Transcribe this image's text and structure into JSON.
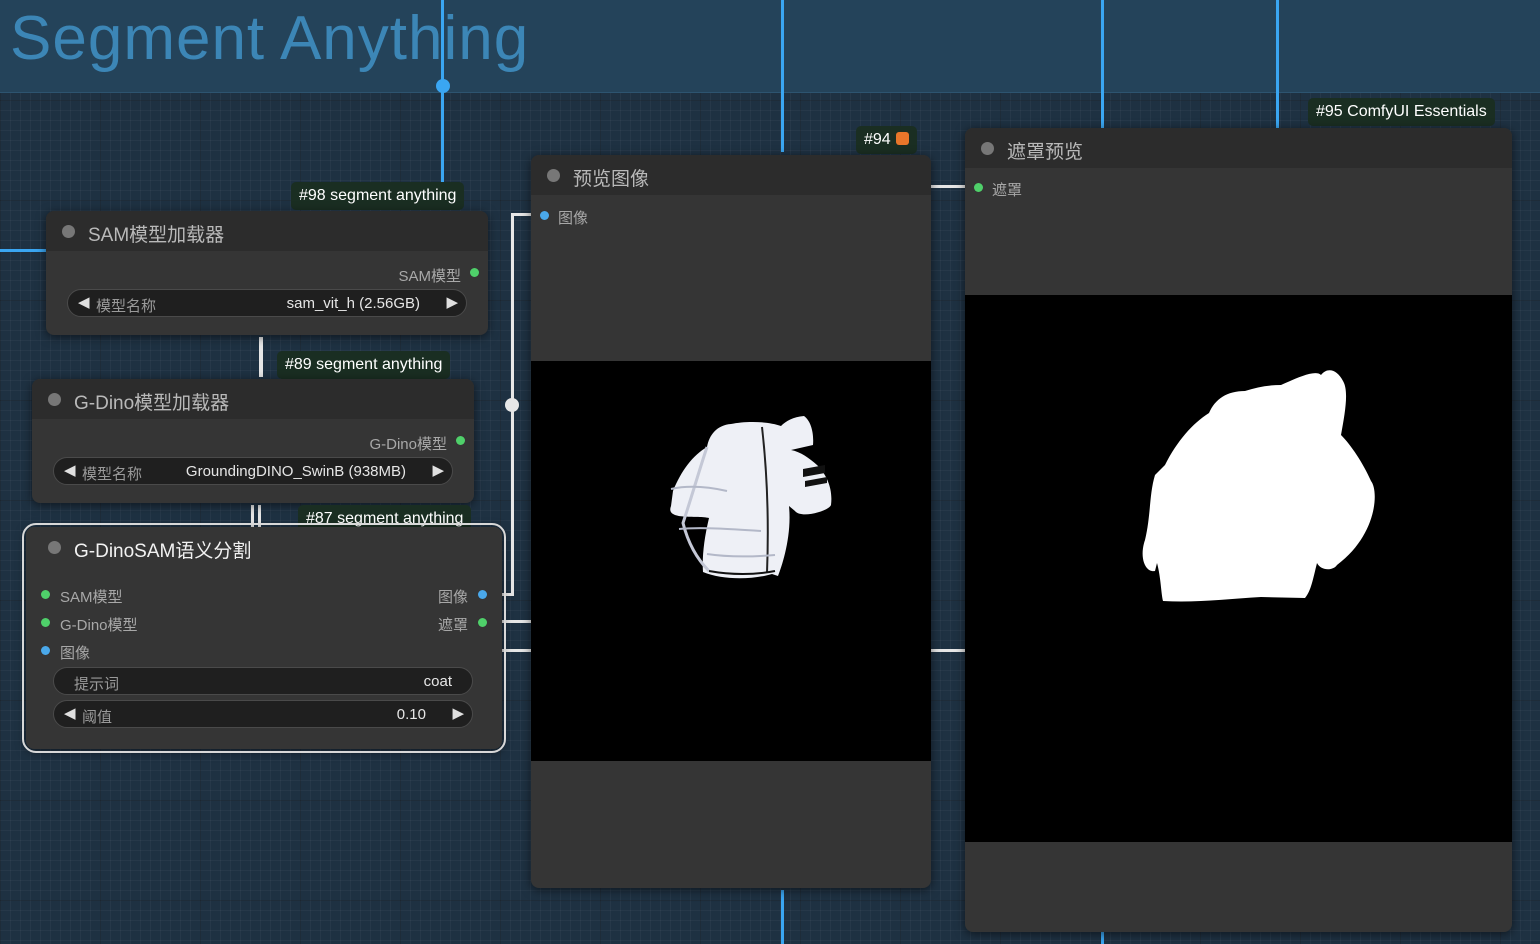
{
  "group": {
    "title": "Segment Anything"
  },
  "nodes": {
    "sam_loader": {
      "badge": "#98 segment anything",
      "title": "SAM模型加载器",
      "output_label": "SAM模型",
      "widget": {
        "label": "模型名称",
        "value": "sam_vit_h (2.56GB)"
      }
    },
    "gdino_loader": {
      "badge": "#89 segment anything",
      "title": "G-Dino模型加载器",
      "output_label": "G-Dino模型",
      "widget": {
        "label": "模型名称",
        "value": "GroundingDINO_SwinB (938MB)"
      }
    },
    "gdinosam": {
      "badge": "#87 segment anything",
      "title": "G-DinoSAM语义分割",
      "inputs": [
        "SAM模型",
        "G-Dino模型",
        "图像"
      ],
      "outputs": [
        "图像",
        "遮罩"
      ],
      "prompt_widget": {
        "label": "提示词",
        "value": "coat"
      },
      "threshold_widget": {
        "label": "阈值",
        "value": "0.10"
      }
    },
    "preview_image": {
      "badge": "#94",
      "title": "预览图像",
      "input_label": "图像"
    },
    "mask_preview": {
      "badge": "#95 ComfyUI Essentials",
      "title": "遮罩预览",
      "input_label": "遮罩"
    }
  },
  "colors": {
    "sam_slot": "#4fd06a",
    "image_slot": "#4aa8ea",
    "link_blue": "#3aa6f2",
    "node_bg": "#353535",
    "canvas_bg": "#1e3142"
  },
  "icons": {
    "arrow_left": "◀",
    "arrow_right": "▶",
    "badge_icon": "fox-icon"
  }
}
